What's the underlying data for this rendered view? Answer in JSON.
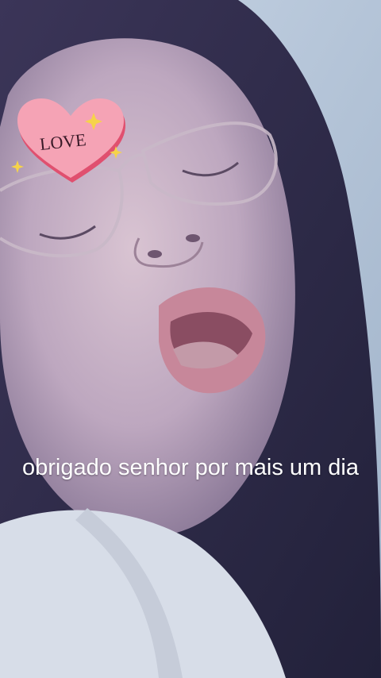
{
  "video": {
    "scene": "selfie-face-icon"
  },
  "sticker": {
    "label": "LOVE",
    "icon": "heart-sticker-icon",
    "colors": {
      "heart_fill": "#f5a3b5",
      "heart_shadow": "#e0506f",
      "text": "#3a1a28",
      "sparkle": "#f6d34a"
    }
  },
  "caption": {
    "text": "obrigado senhor por mais um dia"
  }
}
